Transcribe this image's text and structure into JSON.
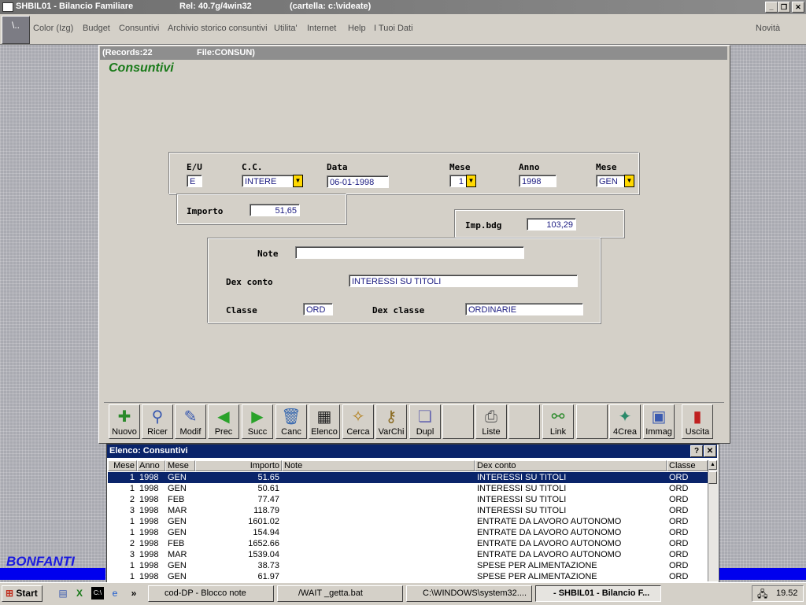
{
  "titlebar": {
    "app": "SHBIL01 - Bilancio Familiare",
    "rel": "Rel: 40.7g/4win32",
    "folder": "(cartella: c:\\videate)",
    "min": "_",
    "restore": "❐",
    "close": "✕"
  },
  "menu": {
    "sys_icon": "\\..",
    "items": [
      "Color (Izg)",
      "Budget",
      "Consuntivi",
      "Archivio storico consuntivi",
      "Utilita'",
      "Internet",
      "Help",
      "I Tuoi Dati"
    ],
    "right": "Novità"
  },
  "form": {
    "records": "(Records:22",
    "file": "File:CONSUN)",
    "title": "Consuntivi",
    "labels": {
      "eu": "E/U",
      "cc": "C.C.",
      "data": "Data",
      "mese": "Mese",
      "anno": "Anno",
      "mese2": "Mese",
      "importo": "Importo",
      "impbdg": "Imp.bdg",
      "note": "Note",
      "dexconto": "Dex conto",
      "classe": "Classe",
      "dexclasse": "Dex classe"
    },
    "values": {
      "eu": "E",
      "cc": "INTERE",
      "data": "06-01-1998",
      "mese": "1",
      "anno": "1998",
      "mese2": "GEN",
      "importo": "51,65",
      "impbdg": "103,29",
      "note": "",
      "dexconto": "INTERESSI SU TITOLI",
      "classe": "ORD",
      "dexclasse": "ORDINARIE"
    }
  },
  "toolbar": {
    "buttons": [
      "Nuovo",
      "Ricer",
      "Modif",
      "Prec",
      "Succ",
      "Canc",
      "Elenco",
      "Cerca",
      "VarChi",
      "Dupl",
      "",
      "Liste",
      "",
      "Link",
      "",
      "4Crea",
      "Immag",
      "Uscita"
    ],
    "icons": [
      "new-doc-icon",
      "search-icon",
      "edit-icon",
      "arrow-left-icon",
      "arrow-right-icon",
      "trash-icon",
      "table-icon",
      "find-icon",
      "keys-icon",
      "duplicate-icon",
      "",
      "printer-icon",
      "",
      "link-icon",
      "",
      "create-icon",
      "image-icon",
      "exit-door-icon"
    ]
  },
  "list": {
    "title": "Elenco: Consuntivi",
    "help": "?",
    "close": "✕",
    "columns": [
      "Mese",
      "Anno",
      "Mese",
      "Importo",
      "Note",
      "Dex conto",
      "Classe"
    ],
    "rows": [
      [
        "1",
        "1998",
        "GEN",
        "51.65",
        "",
        "INTERESSI SU TITOLI",
        "ORD"
      ],
      [
        "1",
        "1998",
        "GEN",
        "50.61",
        "",
        "INTERESSI SU TITOLI",
        "ORD"
      ],
      [
        "2",
        "1998",
        "FEB",
        "77.47",
        "",
        "INTERESSI SU TITOLI",
        "ORD"
      ],
      [
        "3",
        "1998",
        "MAR",
        "118.79",
        "",
        "INTERESSI SU TITOLI",
        "ORD"
      ],
      [
        "1",
        "1998",
        "GEN",
        "1601.02",
        "",
        "ENTRATE DA LAVORO AUTONOMO",
        "ORD"
      ],
      [
        "1",
        "1998",
        "GEN",
        "154.94",
        "",
        "ENTRATE DA LAVORO AUTONOMO",
        "ORD"
      ],
      [
        "2",
        "1998",
        "FEB",
        "1652.66",
        "",
        "ENTRATE DA LAVORO AUTONOMO",
        "ORD"
      ],
      [
        "3",
        "1998",
        "MAR",
        "1539.04",
        "",
        "ENTRATE DA LAVORO AUTONOMO",
        "ORD"
      ],
      [
        "1",
        "1998",
        "GEN",
        "38.73",
        "",
        "SPESE PER ALIMENTAZIONE",
        "ORD"
      ],
      [
        "1",
        "1998",
        "GEN",
        "61.97",
        "",
        "SPESE PER ALIMENTAZIONE",
        "ORD"
      ]
    ]
  },
  "brand": "BONFANTI",
  "taskbar": {
    "start": "Start",
    "quick": [
      "notepad-icon",
      "excel-icon",
      "cmd-icon",
      "ie-icon"
    ],
    "more": "»",
    "tasks": [
      "cod-DP - Blocco note",
      "/WAIT _getta.bat",
      "C:\\WINDOWS\\system32....",
      "- SHBIL01 - Bilancio F..."
    ],
    "clock": "19.52"
  }
}
